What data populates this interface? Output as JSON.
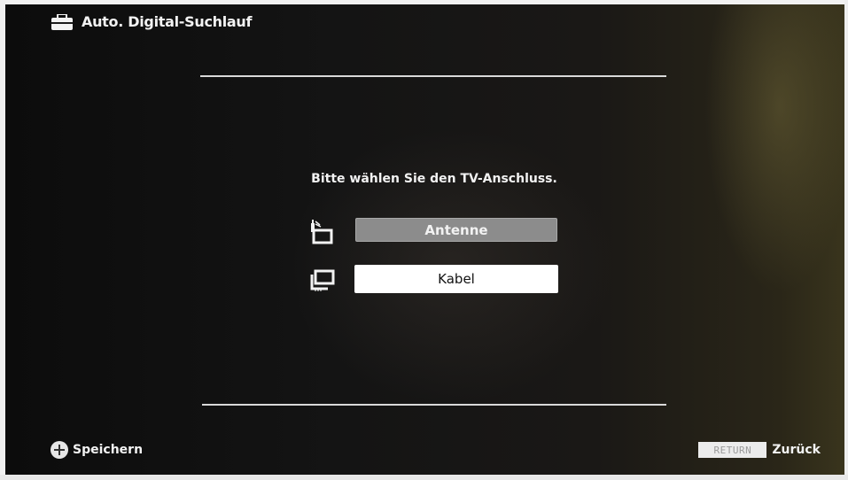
{
  "header": {
    "title": "Auto. Digital-Suchlauf",
    "icon": "toolbox-icon"
  },
  "main": {
    "prompt": "Bitte wählen Sie den TV-Anschluss.",
    "options": [
      {
        "label": "Antenne",
        "icon": "antenna-icon",
        "state": "highlighted"
      },
      {
        "label": "Kabel",
        "icon": "cable-icon",
        "state": "selected"
      }
    ]
  },
  "footer": {
    "left": {
      "icon": "dpad-icon",
      "label": "Speichern"
    },
    "right": {
      "key_label": "RETURN",
      "label": "Zurück"
    }
  },
  "colors": {
    "background": "#0c0c0c",
    "text": "#f2f2f2",
    "highlight": "#8c8c8c",
    "selected": "#ffffff"
  }
}
